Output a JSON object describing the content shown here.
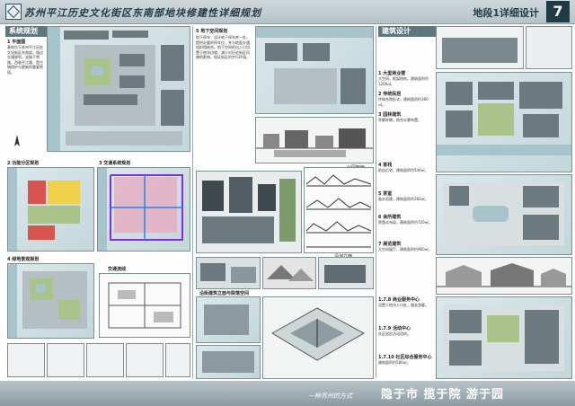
{
  "header": {
    "title": "苏州平江历史文化街区东南部地块修建性详细规划",
    "section": "地段1详细设计",
    "page": "7"
  },
  "left_section": {
    "heading": "系统规划",
    "plan_label": "1 平面图",
    "plan_text": "基地位于苏州平江历史文化街区东南部，周边交通便利，北接干将路，西临平江路，是古城保护与更新的重要地段。",
    "traffic_label": "2 功能分区规划",
    "traffic2_label": "3 交通系统规划",
    "landscape_label": "4 绿地景观规划",
    "node_label": "交通流线"
  },
  "middle_section": {
    "underground_label": "5 地下空间规划",
    "underground_text": "地下停车：设计地下停车库一处，提供必要的停车位，并与地面交通组织相结合。地下空间的出入口设置于地块边缘，减少对历史街区风貌的影响，保证街区的步行环境。",
    "street_label": "沿街立面",
    "section_label": "剖面图",
    "perspective_label": "沿街建筑立面与院落空间",
    "section_caption": "公园剖面",
    "elev_caption": "沿河立面"
  },
  "right_section": {
    "heading": "建筑设计",
    "items": [
      {
        "title": "1 大型商业楼",
        "text": "大空间，框架结构，建筑面积约1200㎡。"
      },
      {
        "title": "2 传统民居",
        "text": "传统合院形式，建筑面积约380㎡。"
      },
      {
        "title": "3 园林建筑",
        "text": "亭廊轩榭，结合水景布置。"
      },
      {
        "title": "4 客栈",
        "text": "前店后宅，建筑面积约540㎡。"
      },
      {
        "title": "5 茶室",
        "text": "临水而建，建筑面积约260㎡。"
      },
      {
        "title": "6 会所建筑",
        "text": "院落式布局，建筑面积约720㎡。"
      },
      {
        "title": "7 展览建筑",
        "text": "大空间展厅，建筑面积约960㎡。"
      },
      {
        "title": "1.7.8 商业服务中心",
        "text": "设置于地块入口处，服务游客。"
      },
      {
        "title": "1.7.9 活动中心",
        "text": "社区居民活动用房。"
      },
      {
        "title": "1.7.10 社区综合服务中心",
        "text": "建筑面积约580㎡。"
      }
    ]
  },
  "footer": {
    "slogan": "一种苏州的方式",
    "names": "隐于市  揽于院  游于园"
  }
}
